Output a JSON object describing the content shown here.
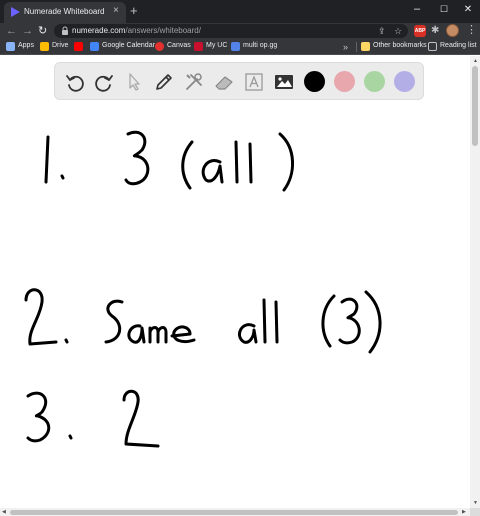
{
  "browser": {
    "tab_title": "Numerade Whiteboard",
    "tab_close": "×",
    "new_tab": "+",
    "window_controls": {
      "minimize": "–",
      "maximize": "☐",
      "close": "✕"
    },
    "url_host": "numerade.com",
    "url_path": "/answers/whiteboard/",
    "extension_abp_label": "ABP",
    "icons": [
      "back-icon",
      "forward-icon",
      "reload-icon",
      "lock-icon",
      "share-icon",
      "star-icon",
      "extensions-icon",
      "avatar",
      "menu-icon"
    ]
  },
  "bookmarks": [
    {
      "label": "Apps",
      "color": "#8ab4f8"
    },
    {
      "label": "Drive",
      "color": "#fbbc04"
    },
    {
      "label": "",
      "color": "#ff0000"
    },
    {
      "label": "Google Calendar",
      "color": "#4285f4"
    },
    {
      "label": "Canvas",
      "color": "#e4312f"
    },
    {
      "label": "My UC",
      "color": "#c8102e"
    },
    {
      "label": "multi op.gg",
      "color": "#5383e8"
    }
  ],
  "other_bookmarks": "Other bookmarks",
  "reading_list": "Reading list",
  "whiteboard": {
    "tools": [
      "undo-icon",
      "redo-icon",
      "select-cursor-icon",
      "pen-icon",
      "tools-icon",
      "eraser-icon",
      "text-tool-icon",
      "image-icon"
    ],
    "colors": [
      {
        "name": "black",
        "hex": "#000000"
      },
      {
        "name": "pink",
        "hex": "#e8a6ad"
      },
      {
        "name": "green",
        "hex": "#a8d5a2"
      },
      {
        "name": "purple",
        "hex": "#b3aee6"
      }
    ],
    "handwriting": [
      "1.  3 (all)",
      "2.  Same  all  (3)",
      "3.  2"
    ]
  }
}
